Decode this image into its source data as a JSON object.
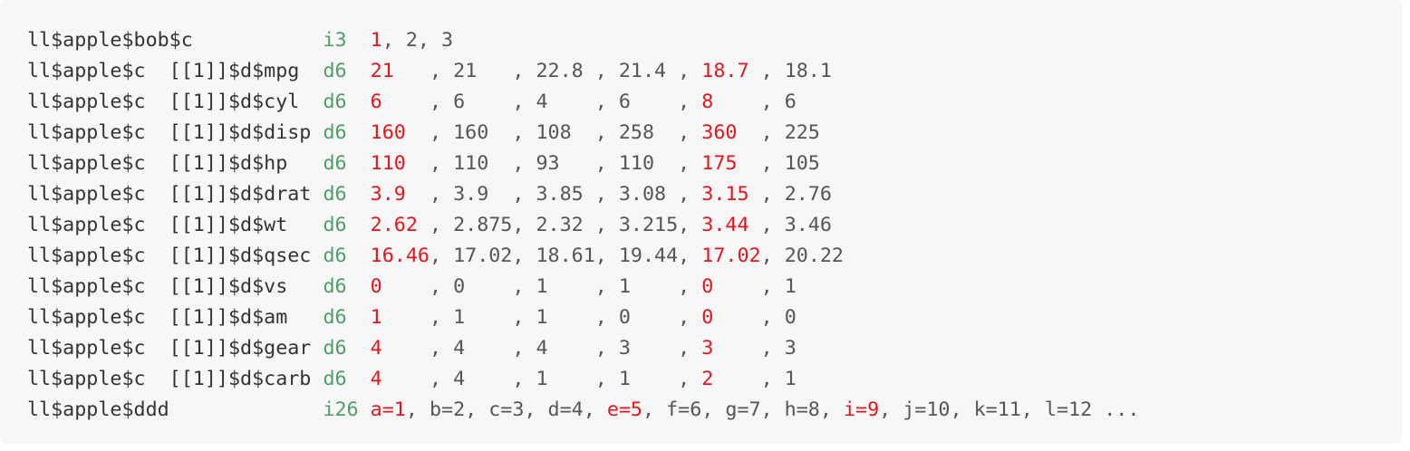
{
  "colors": {
    "background": "#f7f7f7",
    "path_text": "#333333",
    "type_text": "#4f9d69",
    "highlight": "#e8131b",
    "value_text": "#555555"
  },
  "rows": [
    {
      "path": "ll$apple$bob$c           ",
      "type": "i3 ",
      "parts": [
        {
          "text": " ",
          "hl": false
        },
        {
          "text": "1",
          "hl": true
        },
        {
          "text": ", 2, 3",
          "hl": false
        }
      ]
    },
    {
      "path": "ll$apple$c  [[1]]$d$mpg  ",
      "type": "d6 ",
      "parts": [
        {
          "text": " ",
          "hl": false
        },
        {
          "text": "21   ",
          "hl": true
        },
        {
          "text": ", 21   , 22.8 , 21.4 , ",
          "hl": false
        },
        {
          "text": "18.7 ",
          "hl": true
        },
        {
          "text": ", 18.1",
          "hl": false
        }
      ]
    },
    {
      "path": "ll$apple$c  [[1]]$d$cyl  ",
      "type": "d6 ",
      "parts": [
        {
          "text": " ",
          "hl": false
        },
        {
          "text": "6    ",
          "hl": true
        },
        {
          "text": ", 6    , 4    , 6    , ",
          "hl": false
        },
        {
          "text": "8    ",
          "hl": true
        },
        {
          "text": ", 6",
          "hl": false
        }
      ]
    },
    {
      "path": "ll$apple$c  [[1]]$d$disp ",
      "type": "d6 ",
      "parts": [
        {
          "text": " ",
          "hl": false
        },
        {
          "text": "160  ",
          "hl": true
        },
        {
          "text": ", 160  , 108  , 258  , ",
          "hl": false
        },
        {
          "text": "360  ",
          "hl": true
        },
        {
          "text": ", 225",
          "hl": false
        }
      ]
    },
    {
      "path": "ll$apple$c  [[1]]$d$hp   ",
      "type": "d6 ",
      "parts": [
        {
          "text": " ",
          "hl": false
        },
        {
          "text": "110  ",
          "hl": true
        },
        {
          "text": ", 110  , 93   , 110  , ",
          "hl": false
        },
        {
          "text": "175  ",
          "hl": true
        },
        {
          "text": ", 105",
          "hl": false
        }
      ]
    },
    {
      "path": "ll$apple$c  [[1]]$d$drat ",
      "type": "d6 ",
      "parts": [
        {
          "text": " ",
          "hl": false
        },
        {
          "text": "3.9  ",
          "hl": true
        },
        {
          "text": ", 3.9  , 3.85 , 3.08 , ",
          "hl": false
        },
        {
          "text": "3.15 ",
          "hl": true
        },
        {
          "text": ", 2.76",
          "hl": false
        }
      ]
    },
    {
      "path": "ll$apple$c  [[1]]$d$wt   ",
      "type": "d6 ",
      "parts": [
        {
          "text": " ",
          "hl": false
        },
        {
          "text": "2.62 ",
          "hl": true
        },
        {
          "text": ", 2.875, 2.32 , 3.215, ",
          "hl": false
        },
        {
          "text": "3.44 ",
          "hl": true
        },
        {
          "text": ", 3.46",
          "hl": false
        }
      ]
    },
    {
      "path": "ll$apple$c  [[1]]$d$qsec ",
      "type": "d6 ",
      "parts": [
        {
          "text": " ",
          "hl": false
        },
        {
          "text": "16.46",
          "hl": true
        },
        {
          "text": ", 17.02, 18.61, 19.44, ",
          "hl": false
        },
        {
          "text": "17.02",
          "hl": true
        },
        {
          "text": ", 20.22",
          "hl": false
        }
      ]
    },
    {
      "path": "ll$apple$c  [[1]]$d$vs   ",
      "type": "d6 ",
      "parts": [
        {
          "text": " ",
          "hl": false
        },
        {
          "text": "0    ",
          "hl": true
        },
        {
          "text": ", 0    , 1    , 1    , ",
          "hl": false
        },
        {
          "text": "0    ",
          "hl": true
        },
        {
          "text": ", 1",
          "hl": false
        }
      ]
    },
    {
      "path": "ll$apple$c  [[1]]$d$am   ",
      "type": "d6 ",
      "parts": [
        {
          "text": " ",
          "hl": false
        },
        {
          "text": "1    ",
          "hl": true
        },
        {
          "text": ", 1    , 1    , 0    , ",
          "hl": false
        },
        {
          "text": "0    ",
          "hl": true
        },
        {
          "text": ", 0",
          "hl": false
        }
      ]
    },
    {
      "path": "ll$apple$c  [[1]]$d$gear ",
      "type": "d6 ",
      "parts": [
        {
          "text": " ",
          "hl": false
        },
        {
          "text": "4    ",
          "hl": true
        },
        {
          "text": ", 4    , 4    , 3    , ",
          "hl": false
        },
        {
          "text": "3    ",
          "hl": true
        },
        {
          "text": ", 3",
          "hl": false
        }
      ]
    },
    {
      "path": "ll$apple$c  [[1]]$d$carb ",
      "type": "d6 ",
      "parts": [
        {
          "text": " ",
          "hl": false
        },
        {
          "text": "4    ",
          "hl": true
        },
        {
          "text": ", 4    , 1    , 1    , ",
          "hl": false
        },
        {
          "text": "2    ",
          "hl": true
        },
        {
          "text": ", 1",
          "hl": false
        }
      ]
    },
    {
      "path": "ll$apple$ddd             ",
      "type": "i26",
      "parts": [
        {
          "text": " ",
          "hl": false
        },
        {
          "text": "a=1",
          "hl": true
        },
        {
          "text": ", b=2, c=3, d=4, ",
          "hl": false
        },
        {
          "text": "e=5",
          "hl": true
        },
        {
          "text": ", f=6, g=7, h=8, ",
          "hl": false
        },
        {
          "text": "i=9",
          "hl": true
        },
        {
          "text": ", j=10, k=11, l=12 ...",
          "hl": false
        }
      ]
    }
  ]
}
